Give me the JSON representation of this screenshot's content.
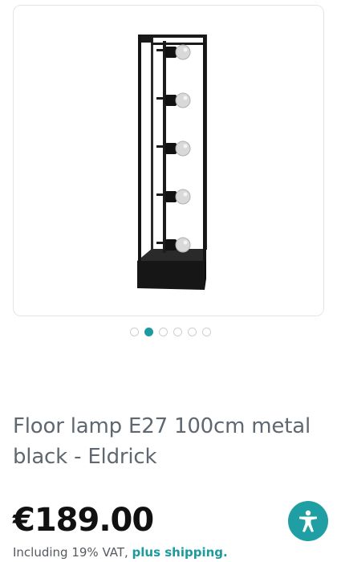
{
  "product": {
    "title": "Floor lamp E27 100cm metal black - Eldrick",
    "price": "€189.00",
    "vat_text": "Including 19% VAT, ",
    "shipping_link": "plus shipping."
  },
  "gallery": {
    "image_count": 6,
    "active_index": 1
  },
  "icons": {
    "accessibility": "accessibility-icon"
  },
  "colors": {
    "accent": "#1d9a9e",
    "title_text": "#5f6770",
    "price_text": "#111111",
    "lamp_frame": "#1a1a1a"
  }
}
